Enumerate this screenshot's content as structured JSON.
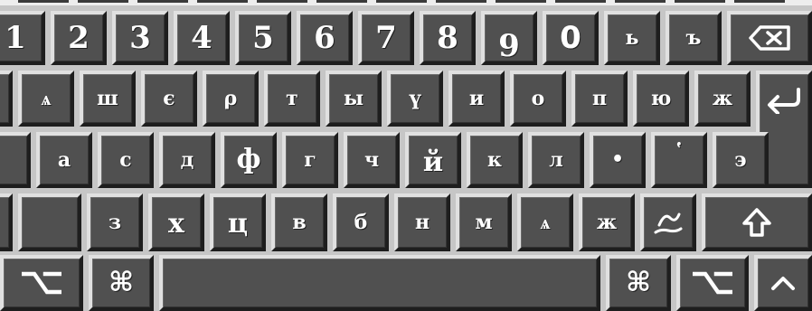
{
  "rows": {
    "digits": [
      "1",
      "2",
      "3",
      "4",
      "5",
      "6",
      "7",
      "8",
      "9",
      "0",
      "ь",
      "ъ"
    ],
    "top": [
      "ѧ",
      "ш",
      "є",
      "ρ",
      "т",
      "ы",
      "ү",
      "и",
      "о",
      "п",
      "ю",
      "ж"
    ],
    "home": [
      "а",
      "с",
      "д",
      "ф",
      "г",
      "ч",
      "й",
      "к",
      "л",
      "•",
      "῾",
      "э"
    ],
    "lower": [
      "з",
      "х",
      "ц",
      "в",
      "б",
      "н",
      "м",
      "ѧ",
      "ж",
      "҃"
    ]
  },
  "modifiers": {
    "backspace": "backspace-icon",
    "enter": "return-icon",
    "shift": "shift-icon",
    "option": "option-icon",
    "command": "⌘",
    "up": "^"
  },
  "colors": {
    "key_face": "#505050",
    "key_highlight": "#e0e0e0",
    "key_shadow": "#1e1e1e",
    "background": "#c6c6c6",
    "legend": "#ffffff"
  }
}
